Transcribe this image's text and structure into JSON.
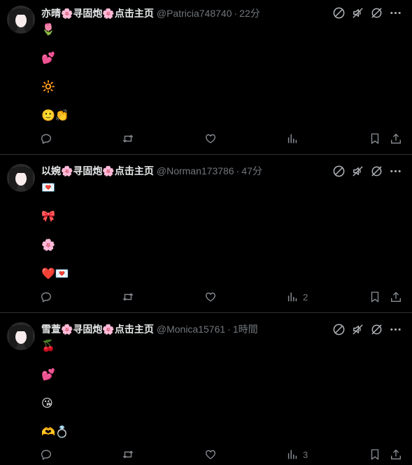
{
  "colors": {
    "background": "#000000",
    "text_primary": "#e7e9ea",
    "text_secondary": "#71767b",
    "divider": "#2f3336"
  },
  "posts": [
    {
      "display_name": "亦晴🌸寻固炮🌸点击主页",
      "handle": "@Patricia748740",
      "separator": "·",
      "time": "22分",
      "lines": [
        "🌷",
        "💕",
        "🔆",
        "🙂👏"
      ],
      "views_count": ""
    },
    {
      "display_name": "以婉🌸寻固炮🌸点击主页",
      "handle": "@Norman173786",
      "separator": "·",
      "time": "47分",
      "lines": [
        "💌",
        "🎀",
        "🌸",
        "❤️💌"
      ],
      "views_count": "2"
    },
    {
      "display_name": "雪萱🌸寻固炮🌸点击主页",
      "handle": "@Monica15761",
      "separator": "·",
      "time": "1時間",
      "lines": [
        "🍒",
        "💕",
        "😘",
        "🫶💍"
      ],
      "views_count": "3"
    }
  ],
  "icons": {
    "top": [
      "grok-icon",
      "mute-icon",
      "block-icon",
      "more-icon"
    ],
    "actions": [
      "reply-icon",
      "retweet-icon",
      "like-icon",
      "views-icon",
      "bookmark-icon",
      "share-icon"
    ]
  }
}
